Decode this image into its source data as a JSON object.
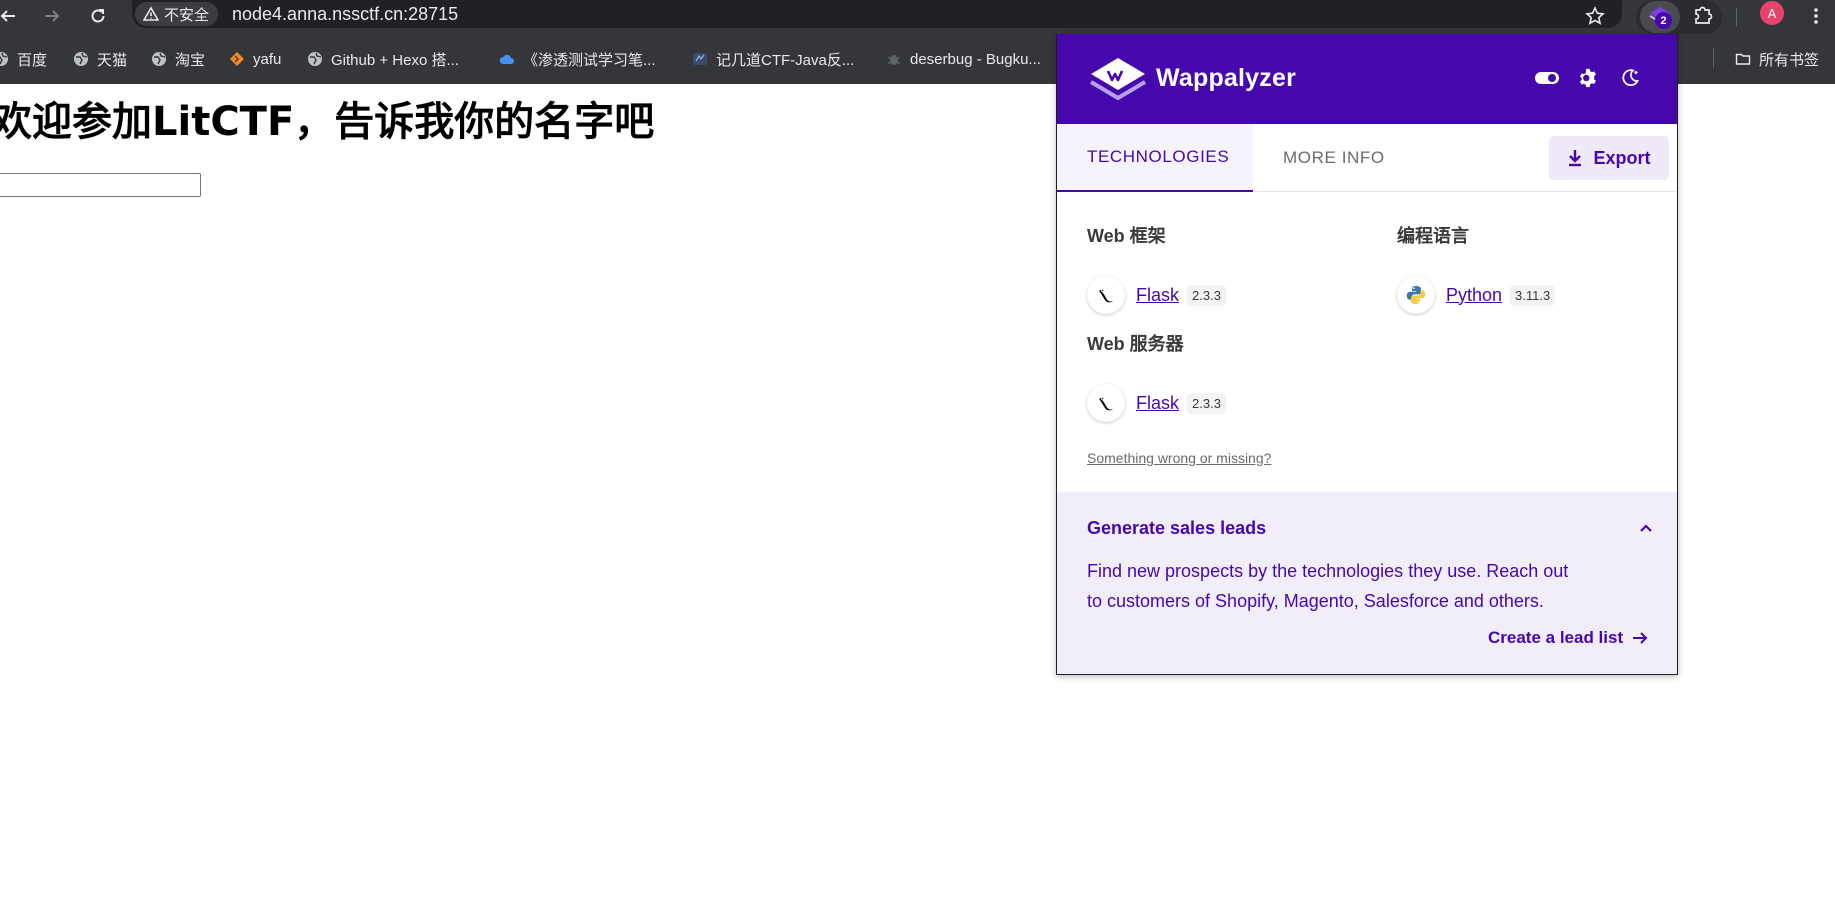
{
  "browser": {
    "security_label": "不安全",
    "url": "node4.anna.nssctf.cn:28715",
    "extension_badge": "2",
    "profile_initial": "A",
    "bookmarks": [
      {
        "label": "百度",
        "icon": "globe-icon"
      },
      {
        "label": "天猫",
        "icon": "globe-icon"
      },
      {
        "label": "淘宝",
        "icon": "globe-icon"
      },
      {
        "label": "yafu",
        "icon": "diamond-icon"
      },
      {
        "label": "Github + Hexo 搭...",
        "icon": "globe-icon"
      },
      {
        "label": "《渗透测试学习笔...",
        "icon": "cloud-icon"
      },
      {
        "label": "记几道CTF-Java反...",
        "icon": "sf-icon"
      },
      {
        "label": "deserbug - Bugku...",
        "icon": "bug-icon"
      }
    ],
    "all_bookmarks_label": "所有书签"
  },
  "page": {
    "heading": "欢迎参加LitCTF，告诉我你的名字吧",
    "input_value": ""
  },
  "wappalyzer": {
    "brand": "Wappalyzer",
    "tabs": {
      "technologies": "TECHNOLOGIES",
      "more_info": "MORE INFO"
    },
    "export_label": "Export",
    "categories": [
      {
        "title": "Web 框架",
        "tech": {
          "name": "Flask",
          "version": "2.3.3",
          "icon": "flask-icon"
        }
      },
      {
        "title": "编程语言",
        "tech": {
          "name": "Python",
          "version": "3.11.3",
          "icon": "python-icon"
        }
      },
      {
        "title": "Web 服务器",
        "tech": {
          "name": "Flask",
          "version": "2.3.3",
          "icon": "flask-icon"
        }
      }
    ],
    "wrong_link": "Something wrong or missing?",
    "leads": {
      "title": "Generate sales leads",
      "description_line1": "Find new prospects by the technologies they use. Reach out",
      "description_line2": "to customers of Shopify, Magento, Salesforce and others.",
      "cta": "Create a lead list"
    },
    "colors": {
      "brand": "#4608ad",
      "leads_bg": "#f1eefa"
    }
  }
}
